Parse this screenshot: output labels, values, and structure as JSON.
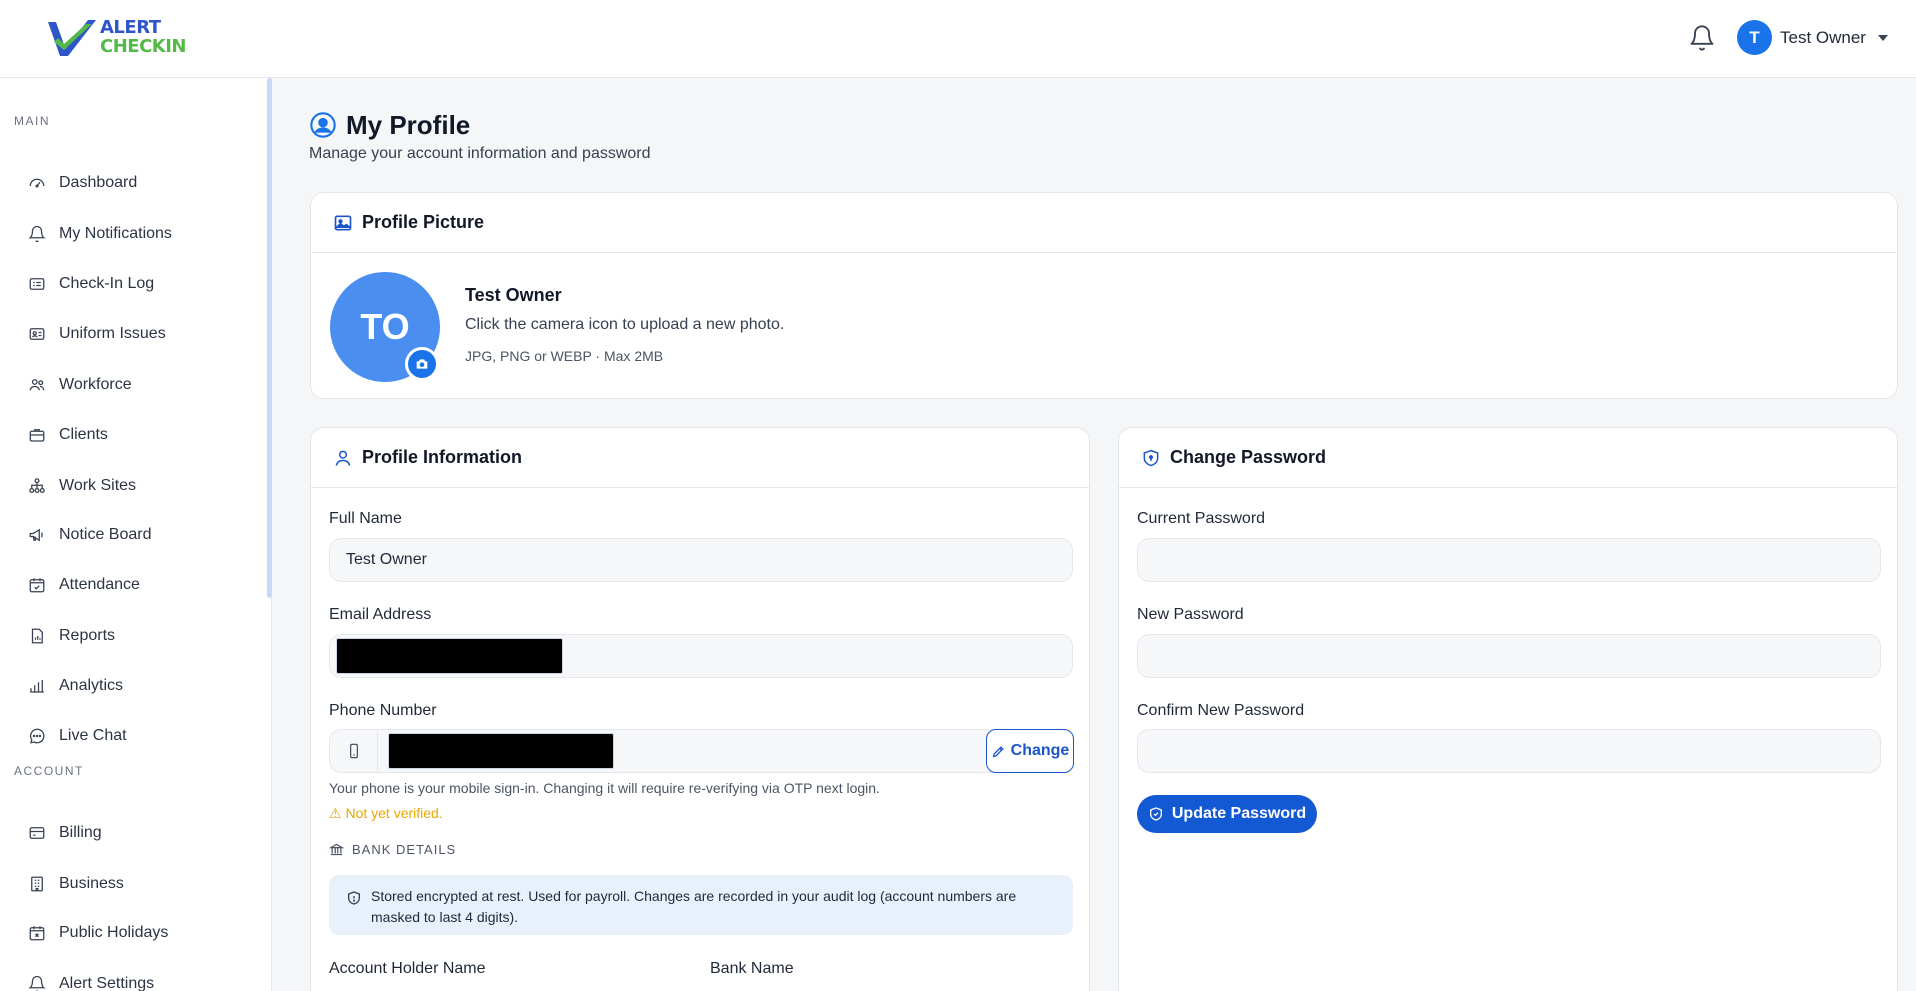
{
  "app": {
    "logo_line1": "ALERT",
    "logo_line2": "CHECKIN"
  },
  "header": {
    "user_initial": "T",
    "user_name": "Test Owner"
  },
  "sidebar": {
    "section_main": "MAIN",
    "section_account": "ACCOUNT",
    "main_items": [
      {
        "label": "Dashboard",
        "icon": "gauge-icon"
      },
      {
        "label": "My Notifications",
        "icon": "bell-icon"
      },
      {
        "label": "Check-In Log",
        "icon": "list-card-icon"
      },
      {
        "label": "Uniform Issues",
        "icon": "id-card-icon"
      },
      {
        "label": "Workforce",
        "icon": "people-icon"
      },
      {
        "label": "Clients",
        "icon": "briefcase-icon"
      },
      {
        "label": "Work Sites",
        "icon": "diagram-icon"
      },
      {
        "label": "Notice Board",
        "icon": "megaphone-icon"
      },
      {
        "label": "Attendance",
        "icon": "calendar-check-icon"
      },
      {
        "label": "Reports",
        "icon": "report-icon"
      },
      {
        "label": "Analytics",
        "icon": "bar-chart-icon"
      },
      {
        "label": "Live Chat",
        "icon": "chat-icon"
      }
    ],
    "account_items": [
      {
        "label": "Billing",
        "icon": "credit-card-icon"
      },
      {
        "label": "Business",
        "icon": "building-icon"
      },
      {
        "label": "Public Holidays",
        "icon": "calendar-x-icon"
      },
      {
        "label": "Alert Settings",
        "icon": "bell-icon"
      }
    ]
  },
  "page": {
    "title": "My Profile",
    "subtitle": "Manage your account information and password"
  },
  "profile_picture": {
    "title": "Profile Picture",
    "initials": "TO",
    "name": "Test Owner",
    "hint": "Click the camera icon to upload a new photo.",
    "formats": "JPG, PNG or WEBP · Max 2MB"
  },
  "profile_info": {
    "title": "Profile Information",
    "full_name_label": "Full Name",
    "full_name_value": "Test Owner",
    "email_label": "Email Address",
    "phone_label": "Phone Number",
    "change_label": "Change",
    "phone_note": "Your phone is your mobile sign-in. Changing it will require re-verifying via OTP next login.",
    "not_verified": "Not yet verified.",
    "bank_heading": "BANK DETAILS",
    "bank_note": "Stored encrypted at rest. Used for payroll. Changes are recorded in your audit log (account numbers are masked to last 4 digits).",
    "account_holder_label": "Account Holder Name",
    "bank_name_label": "Bank Name"
  },
  "change_password": {
    "title": "Change Password",
    "current_label": "Current Password",
    "new_label": "New Password",
    "confirm_label": "Confirm New Password",
    "update_label": "Update Password"
  },
  "colors": {
    "primary": "#1a73e8",
    "warning": "#e6a700",
    "logo_blue": "#2e56c9",
    "logo_green": "#54b948"
  }
}
